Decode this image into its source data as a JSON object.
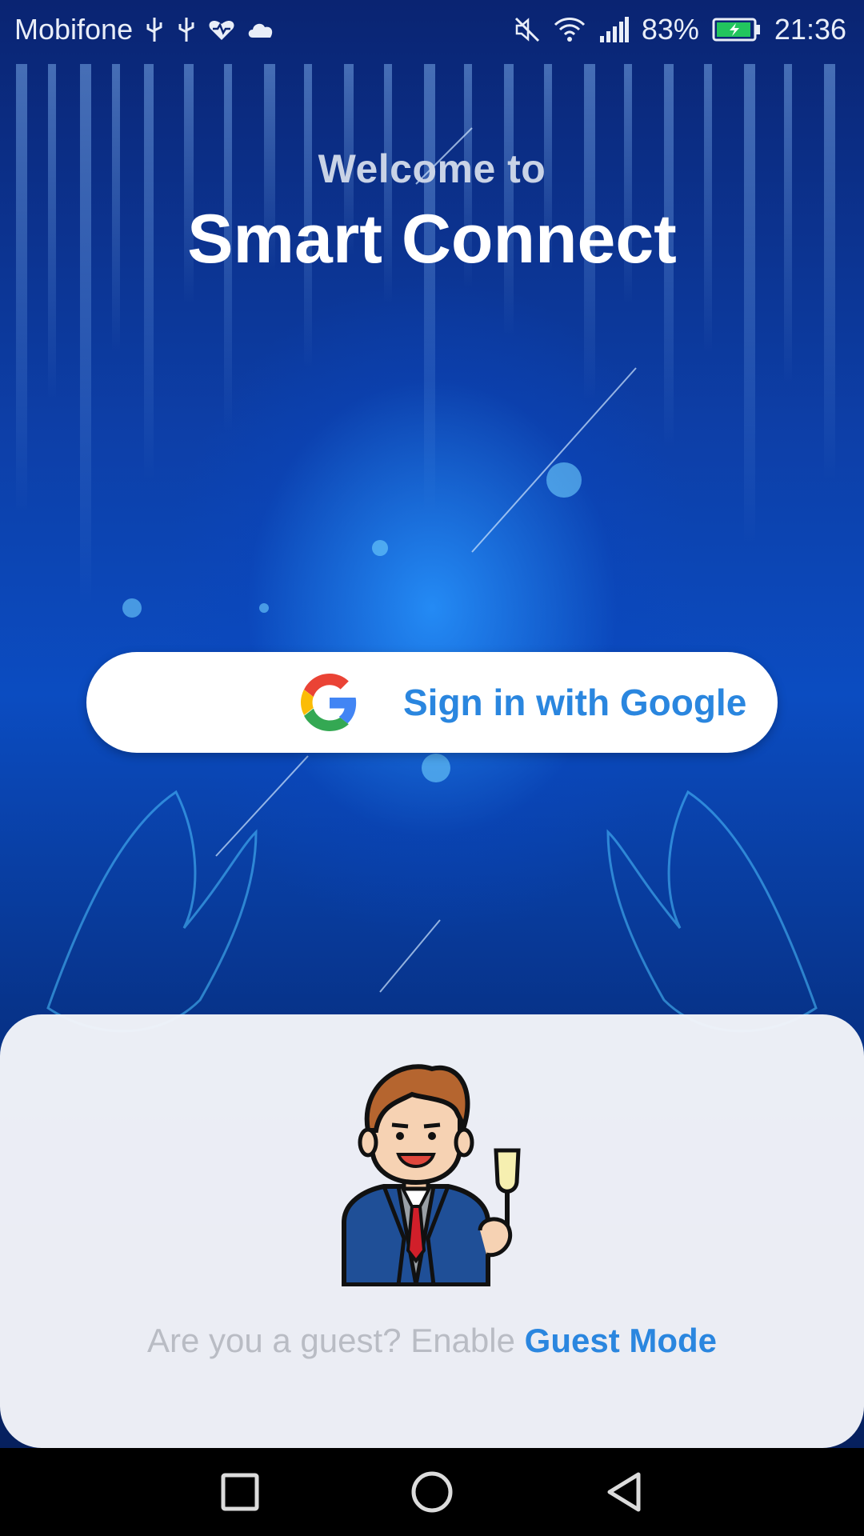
{
  "status_bar": {
    "carrier": "Mobifone",
    "battery_percent": "83%",
    "time": "21:36",
    "left_icons": [
      "usb-icon",
      "usb-icon",
      "health-icon",
      "cloud-icon"
    ],
    "right_icons": [
      "mute-icon",
      "wifi-icon",
      "signal-icon",
      "battery-charging-icon"
    ]
  },
  "welcome": {
    "greeting": "Welcome to",
    "app_name": "Smart Connect"
  },
  "google_button": {
    "label": "Sign in with Google",
    "icon": "google-logo-icon"
  },
  "guest": {
    "prompt": "Are you a guest? Enable",
    "link_label": "Guest Mode",
    "avatar": "businessman-with-champagne-icon"
  },
  "colors": {
    "accent": "#2a86df",
    "background_dark": "#0a2472",
    "card": "#f5f6fa"
  },
  "nav_bar": [
    "recent-apps-icon",
    "home-icon",
    "back-icon"
  ]
}
